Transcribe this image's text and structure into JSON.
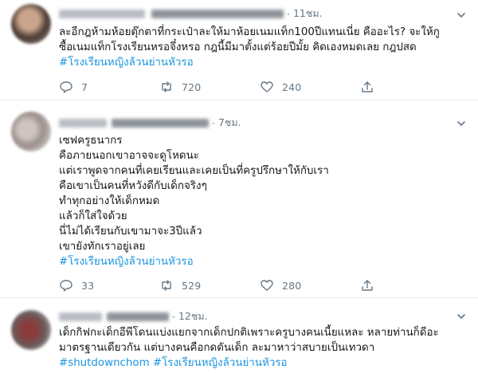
{
  "tweets": [
    {
      "time": "11ชม.",
      "text": "ละอีกฎห้ามห้อยตุ๊กตาที่กระเป๋าละให้มาห้อยเนมแท็ก100ปีแทนเนี่ย คืออะไร? จะให้กู\nซื้อเนมแท็กโรงเรียนหรอจึ๋งหรอ กฎนี้มีมาตั้งแต่ร้อยปีมั้ย คิดเองหมดเลย กฎปสด",
      "hashtags": "#โรงเรียนหญิงล้วนย่านหัวรอ",
      "replies": "7",
      "retweets": "720",
      "likes": "240"
    },
    {
      "time": "7ชม.",
      "text": "เซฟครูธนากร\nคือภายนอกเขาอาจจะดูโหดนะ\nแต่เราพูดจากคนที่เคยเรียนและเคยเป็นที่ครูปรึกษาให้กับเรา\nคือเขาเป็นคนที่หวังดีกับเด็กจริงๆ\nทำทุกอย่างให้เด็กหมด\nแล้วก็ใส่ใจด้วย\nนี่ไม่ได้เรียนกับเขามาจะ3ปีแล้ว\nเขายังทักเราอยู่เลย",
      "hashtags": "#โรงเรียนหญิงล้วนย่านหัวรอ",
      "replies": "33",
      "retweets": "529",
      "likes": "280"
    },
    {
      "time": "12ชม.",
      "text": "เด็กกิฟกะเด็กอีพีโดนแบ่งแยกจากเด็กปกติเพราะครูบางคนเนี้ยแหละ หลายท่านก็ดีอะ\nมาตรฐานเดียวกัน แต่บางคนคือกดดันเด็ก ละมาหาว่าสบายเป็นเทวดา",
      "hashtags": "#shutdownchom #โรงเรียนหญิงล้วนย่านหัวรอ"
    }
  ],
  "icons": {
    "reply": "reply-icon",
    "retweet": "retweet-icon",
    "like": "heart-icon",
    "share": "share-icon",
    "more": "chevron-down-icon"
  },
  "colors": {
    "hashtag": "#1b95e0",
    "meta": "#657786",
    "divider": "#e6ecf0"
  }
}
